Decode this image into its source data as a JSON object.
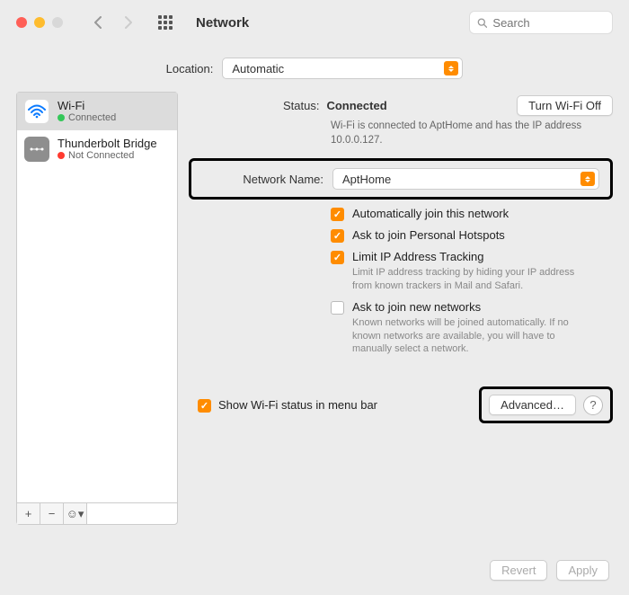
{
  "window": {
    "title": "Network"
  },
  "search": {
    "placeholder": "Search"
  },
  "location": {
    "label": "Location:",
    "value": "Automatic"
  },
  "sidebar": {
    "items": [
      {
        "name": "Wi-Fi",
        "status": "Connected"
      },
      {
        "name": "Thunderbolt Bridge",
        "status": "Not Connected"
      }
    ]
  },
  "status": {
    "label": "Status:",
    "value": "Connected",
    "toggle": "Turn Wi-Fi Off",
    "desc": "Wi-Fi is connected to AptHome and has the IP address 10.0.0.127."
  },
  "network_name": {
    "label": "Network Name:",
    "value": "AptHome"
  },
  "opts": {
    "auto_join": "Automatically join this network",
    "hotspots": "Ask to join Personal Hotspots",
    "limit_ip": "Limit IP Address Tracking",
    "limit_ip_desc": "Limit IP address tracking by hiding your IP address from known trackers in Mail and Safari.",
    "ask_new": "Ask to join new networks",
    "ask_new_desc": "Known networks will be joined automatically. If no known networks are available, you will have to manually select a network."
  },
  "menubar": "Show Wi-Fi status in menu bar",
  "buttons": {
    "advanced": "Advanced…",
    "help": "?",
    "revert": "Revert",
    "apply": "Apply"
  },
  "colors": {
    "accent": "#ff8c00"
  }
}
